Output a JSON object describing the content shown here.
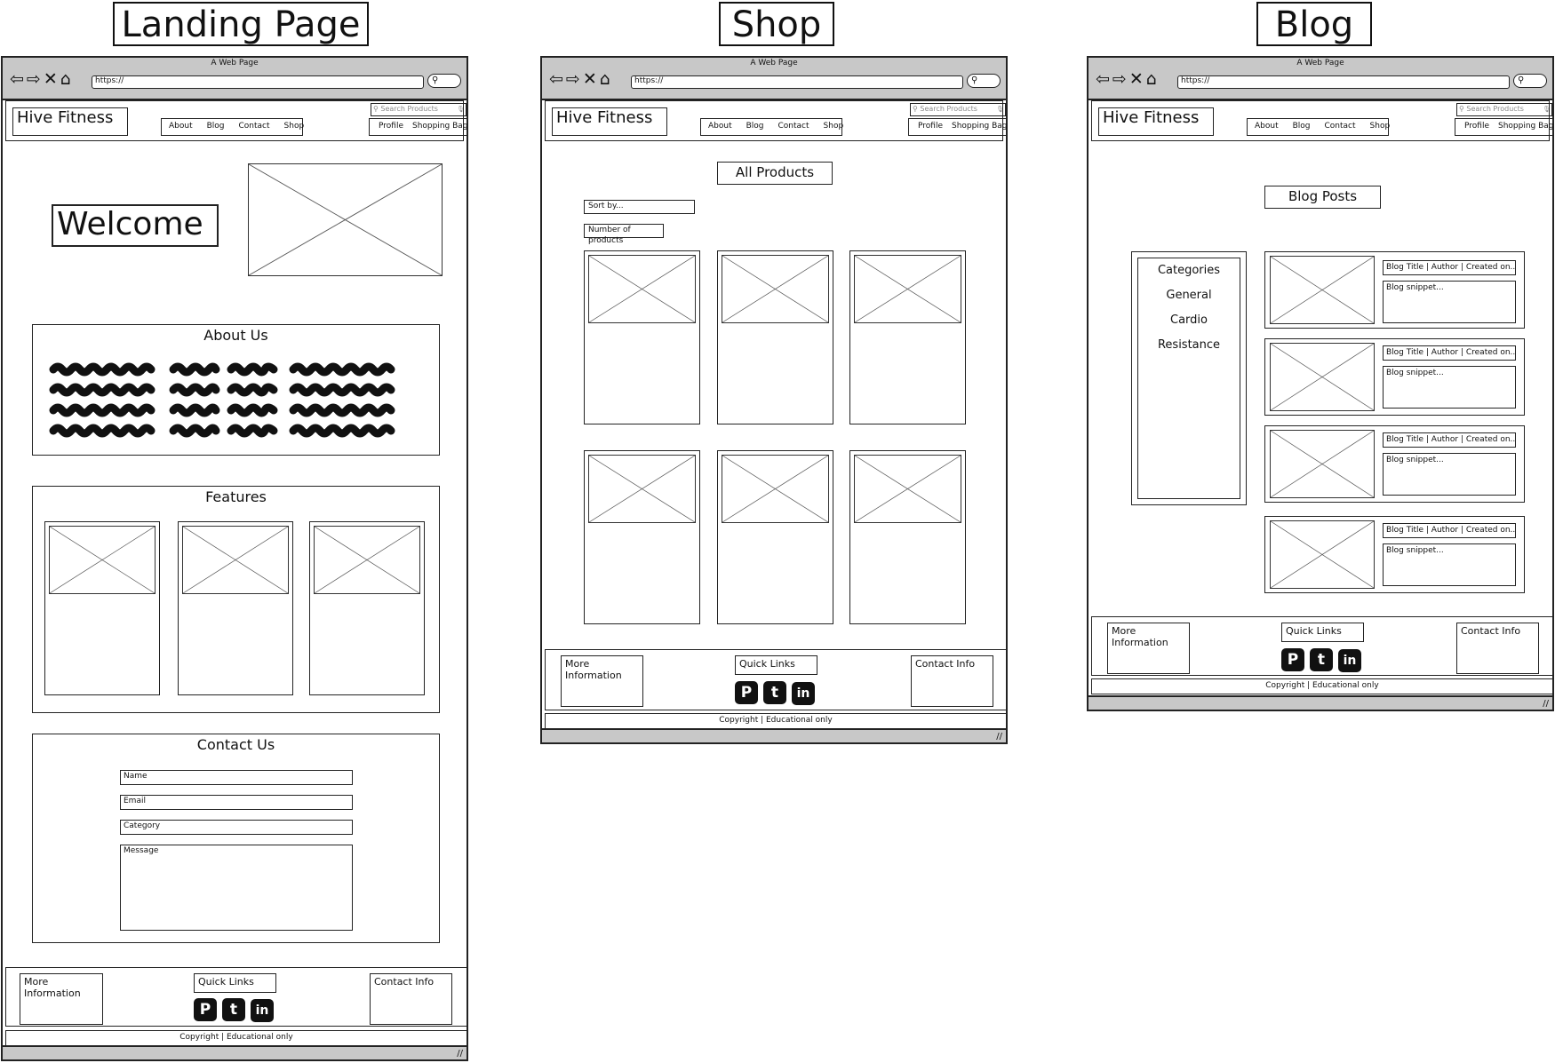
{
  "page_titles": {
    "landing": "Landing Page",
    "shop": "Shop",
    "blog": "Blog"
  },
  "browser": {
    "window_title": "A Web Page",
    "url": "https://",
    "nav_icons": "⇦⇨✕⌂",
    "search_glyph": "⚲"
  },
  "header": {
    "brand": "Hive Fitness",
    "nav": [
      "About",
      "Blog",
      "Contact",
      "Shop"
    ],
    "search_placeholder": "Search Products",
    "mic": "🎙",
    "profile": "Profile",
    "bag": "Shopping Bag"
  },
  "landing": {
    "welcome": "Welcome",
    "about_title": "About Us",
    "features_title": "Features",
    "contact_title": "Contact Us",
    "form": {
      "name": "Name",
      "email": "Email",
      "category": "Category",
      "message": "Message"
    }
  },
  "shop": {
    "title": "All Products",
    "sort": "Sort by...",
    "number": "Number of products"
  },
  "blog": {
    "title": "Blog Posts",
    "categories_title": "Categories",
    "categories": [
      "General",
      "Cardio",
      "Resistance"
    ],
    "post_title": "Blog Title | Author | Created on..",
    "post_snippet": "Blog snippet..."
  },
  "footer": {
    "more": "More Information",
    "quick": "Quick Links",
    "contact": "Contact Info",
    "copyright": "Copyright | Educational only",
    "social": [
      {
        "name": "pinterest",
        "glyph": "P"
      },
      {
        "name": "twitter",
        "glyph": "t"
      },
      {
        "name": "linkedin",
        "glyph": "in"
      }
    ]
  },
  "grip": "//"
}
